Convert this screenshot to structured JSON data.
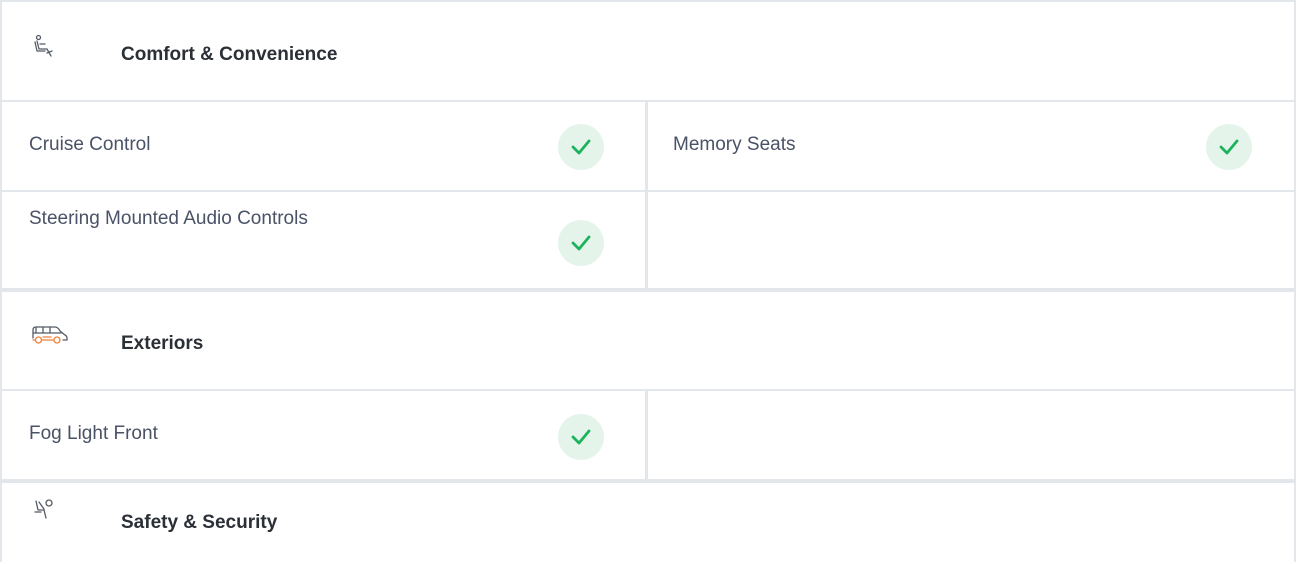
{
  "sections": [
    {
      "title": "Comfort & Convenience",
      "icon": "seat-icon",
      "rows": [
        {
          "left": {
            "label": "Cruise Control",
            "available": true
          },
          "right": {
            "label": "Memory Seats",
            "available": true
          }
        },
        {
          "left": {
            "label": "Steering Mounted Audio Controls",
            "available": true
          },
          "right": null
        }
      ]
    },
    {
      "title": "Exteriors",
      "icon": "car-icon",
      "rows": [
        {
          "left": {
            "label": "Fog Light Front",
            "available": true
          },
          "right": null
        }
      ]
    },
    {
      "title": "Safety & Security",
      "icon": "seatbelt-icon",
      "rows": []
    }
  ],
  "colors": {
    "border": "#e3e7ec",
    "check_bg": "#e4f4ea",
    "check_mark": "#1cb35a",
    "accent_icon": "#f0813a"
  }
}
